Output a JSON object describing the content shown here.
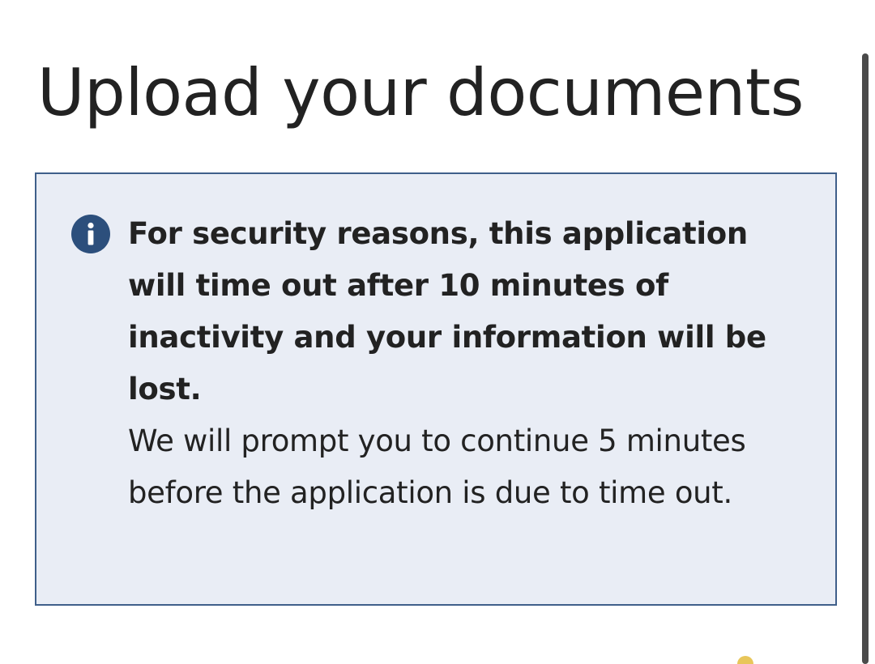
{
  "page": {
    "title": "Upload your documents"
  },
  "notice": {
    "icon": "info-icon",
    "accent_color": "#2c4f7c",
    "background_color": "#e9edf5",
    "border_color": "#3f5f8a",
    "bold_message": "For security reasons, this application will time out after 10 minutes of inactivity and your information will be lost.",
    "message": "We will prompt you to continue 5 minutes before the application is due to time out."
  },
  "scrollbar": {
    "color": "#4a4a4a"
  }
}
